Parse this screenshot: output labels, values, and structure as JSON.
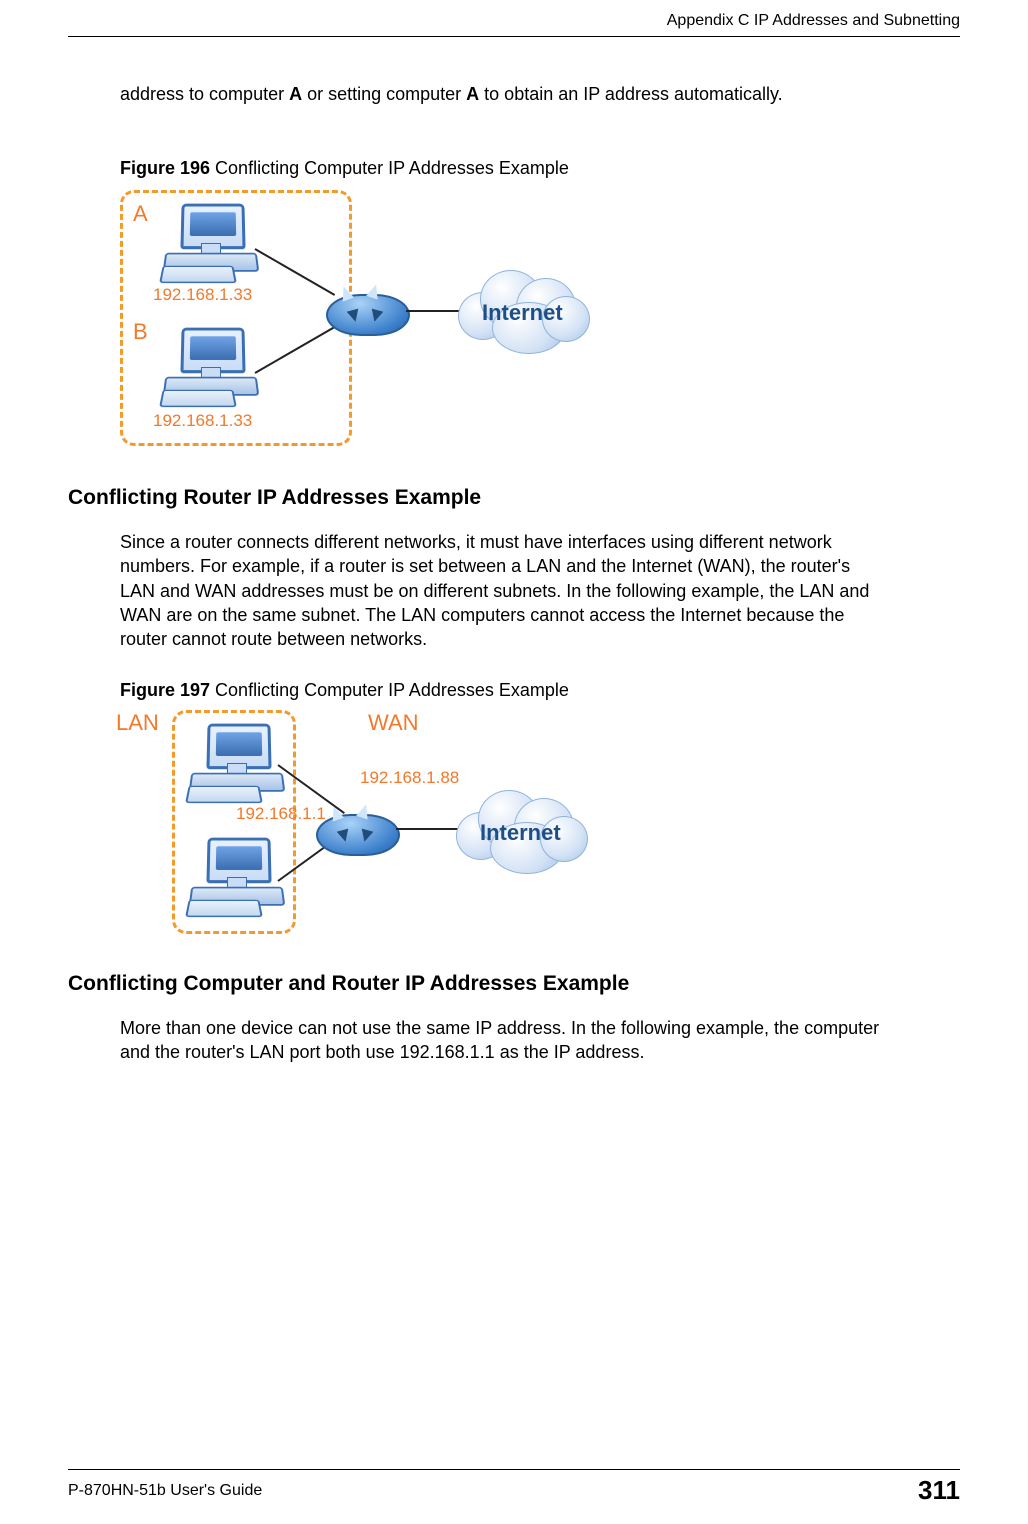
{
  "header": {
    "right": "Appendix C IP Addresses and Subnetting"
  },
  "footer": {
    "left": "P-870HN-51b User's Guide",
    "pageno": "311"
  },
  "para1_a": "address to computer ",
  "para1_b": "A",
  "para1_c": " or setting computer ",
  "para1_d": "A",
  "para1_e": " to obtain an IP address automatically.",
  "fig196": {
    "num": "Figure 196",
    "caption": "   Conflicting Computer IP Addresses Example",
    "labelA": "A",
    "ipA": "192.168.1.33",
    "labelB": "B",
    "ipB": "192.168.1.33",
    "cloud": "Internet"
  },
  "h1": "Conflicting Router IP Addresses Example",
  "para2": "Since a router connects different networks, it must have interfaces using different network numbers. For example, if a router is set between a LAN and the Internet (WAN), the router's LAN and WAN addresses must be on different subnets. In the following example, the LAN and WAN are on the same subnet. The LAN computers cannot access the Internet because the router cannot route between networks.",
  "fig197": {
    "num": "Figure 197",
    "caption": "   Conflicting Computer IP Addresses Example",
    "lan": "LAN",
    "wan": "WAN",
    "lanip": "192.168.1.1",
    "wanip": "192.168.1.88",
    "cloud": "Internet"
  },
  "h2": "Conflicting Computer and Router IP Addresses Example",
  "para3": "More than one device can not use the same IP address. In the following example, the computer and the router's LAN port both use 192.168.1.1 as the IP address."
}
